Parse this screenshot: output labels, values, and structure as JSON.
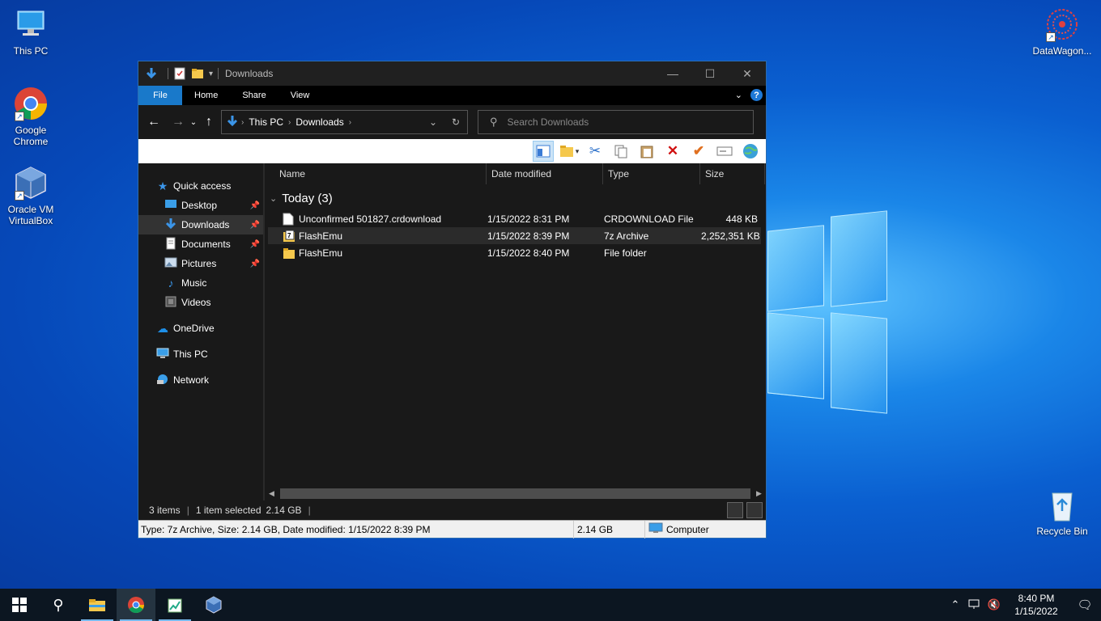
{
  "desktop": {
    "icons": [
      {
        "label": "This PC",
        "icon": "this-pc-icon"
      },
      {
        "label": "Google Chrome",
        "icon": "chrome-icon"
      },
      {
        "label": "Oracle VM VirtualBox",
        "icon": "virtualbox-icon"
      },
      {
        "label": "DataWagon...",
        "icon": "datawagon-icon"
      },
      {
        "label": "Recycle Bin",
        "icon": "recycle-bin-icon"
      }
    ]
  },
  "window": {
    "title": "Downloads",
    "ribbon_tabs": [
      "File",
      "Home",
      "Share",
      "View"
    ],
    "help_label": "?",
    "address": {
      "crumbs": [
        "This PC",
        "Downloads"
      ]
    },
    "search": {
      "placeholder": "Search Downloads"
    },
    "columns": [
      "Name",
      "Date modified",
      "Type",
      "Size"
    ],
    "group_label": "Today (3)",
    "files": [
      {
        "name": "Unconfirmed 501827.crdownload",
        "date": "1/15/2022 8:31 PM",
        "type": "CRDOWNLOAD File",
        "size": "448 KB",
        "icon": "document-icon",
        "selected": false
      },
      {
        "name": "FlashEmu",
        "date": "1/15/2022 8:39 PM",
        "type": "7z Archive",
        "size": "2,252,351 KB",
        "icon": "archive-7z-icon",
        "selected": true
      },
      {
        "name": "FlashEmu",
        "date": "1/15/2022 8:40 PM",
        "type": "File folder",
        "size": "",
        "icon": "folder-icon",
        "selected": false
      }
    ],
    "nav_pane": {
      "quick_access": "Quick access",
      "items": [
        {
          "label": "Desktop",
          "icon": "desktop-icon",
          "pinned": true
        },
        {
          "label": "Downloads",
          "icon": "download-icon",
          "pinned": true,
          "selected": true
        },
        {
          "label": "Documents",
          "icon": "documents-icon",
          "pinned": true
        },
        {
          "label": "Pictures",
          "icon": "pictures-icon",
          "pinned": true
        },
        {
          "label": "Music",
          "icon": "music-icon",
          "pinned": false
        },
        {
          "label": "Videos",
          "icon": "videos-icon",
          "pinned": false
        }
      ],
      "onedrive": "OneDrive",
      "this_pc": "This PC",
      "network": "Network"
    },
    "status": {
      "items": "3 items",
      "selected": "1 item selected",
      "size": "2.14 GB"
    },
    "details": {
      "description": "Type: 7z Archive, Size: 2.14 GB, Date modified: 1/15/2022 8:39 PM",
      "size": "2.14 GB",
      "location": "Computer"
    }
  },
  "taskbar": {
    "apps": [
      "start-icon",
      "search-icon",
      "file-explorer-icon",
      "chrome-icon",
      "notepad-icon",
      "virtualbox-icon"
    ],
    "clock": {
      "time": "8:40 PM",
      "date": "1/15/2022"
    }
  },
  "colors": {
    "accent": "#1979ca",
    "window_bg": "#191919",
    "taskbar_bg": "#0c1621"
  }
}
